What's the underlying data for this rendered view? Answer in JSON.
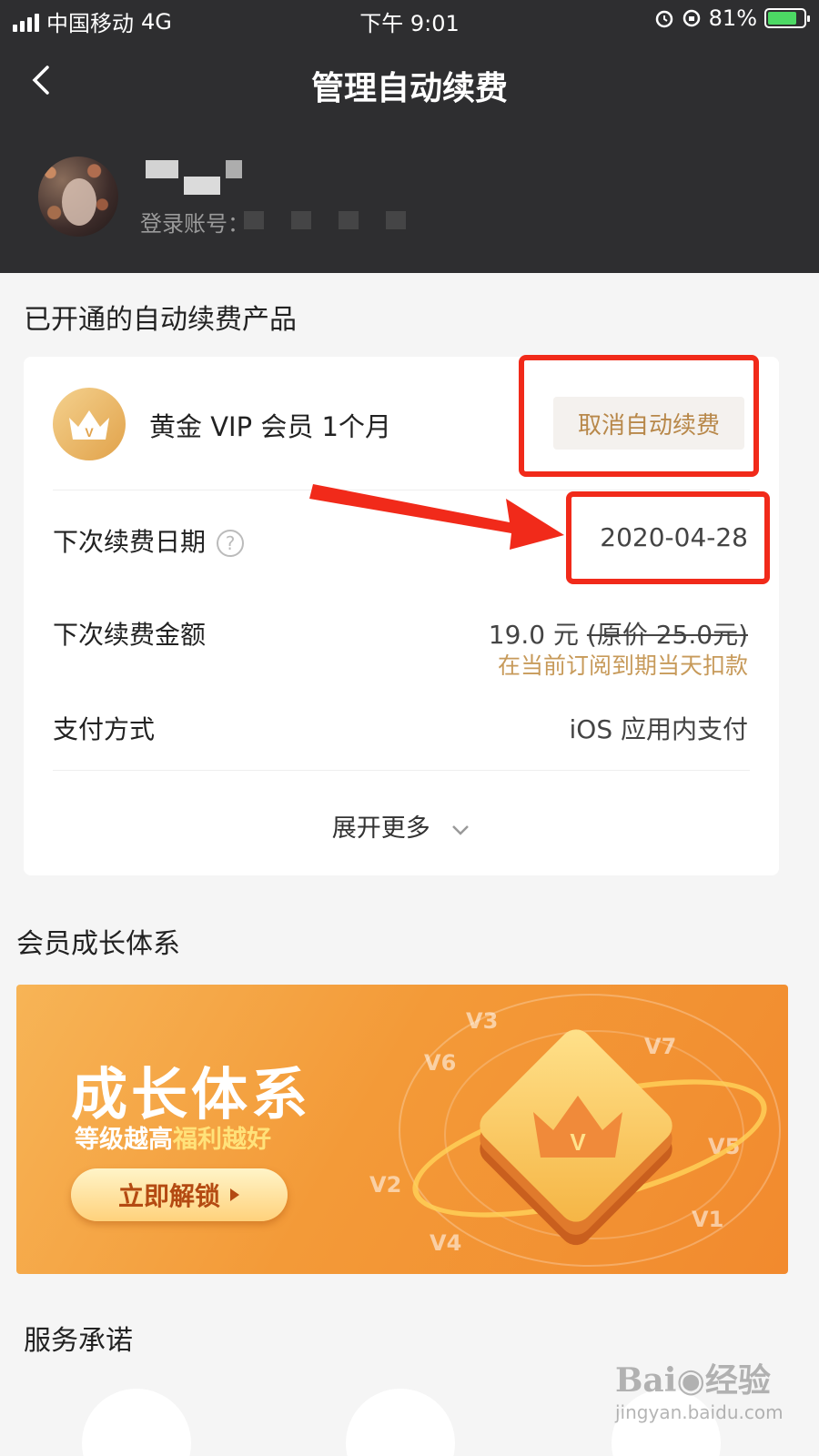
{
  "status_bar": {
    "carrier": "中国移动",
    "network": "4G",
    "time": "下午 9:01",
    "battery": "81%",
    "battery_level": 0.81
  },
  "nav": {
    "title": "管理自动续费",
    "back_icon": "chevron-left-icon"
  },
  "profile": {
    "account_label": "登录账号："
  },
  "subscriptions": {
    "section_title": "已开通的自动续费产品",
    "product_name": "黄金 VIP 会员 1个月",
    "product_icon_letter": "V",
    "cancel_label": "取消自动续费",
    "next_date_label": "下次续费日期",
    "help_symbol": "?",
    "next_date_value": "2020-04-28",
    "next_amount_label": "下次续费金额",
    "next_amount_value": "19.0 元",
    "original_price": "(原价 25.0元)",
    "deduct_hint": "在当前订阅到期当天扣款",
    "payment_label": "支付方式",
    "payment_value": "iOS 应用内支付",
    "expand_label": "展开更多"
  },
  "growth": {
    "section_title": "会员成长体系",
    "banner_title": "成长体系",
    "banner_sub_a": "等级越高",
    "banner_sub_b": "福利越好",
    "banner_button": "立即解锁",
    "levels": [
      "V3",
      "V7",
      "V6",
      "V5",
      "V2",
      "V1",
      "V4"
    ],
    "crown_letter": "V"
  },
  "service": {
    "section_title": "服务承诺"
  },
  "watermark": {
    "brand": "Bai",
    "brand_cn": "经验",
    "url": "jingyan.baidu.com"
  },
  "colors": {
    "header_bg": "#2e2e30",
    "accent_gold": "#b8884a",
    "highlight_red": "#f12a1a",
    "banner_orange": "#f39a38"
  }
}
